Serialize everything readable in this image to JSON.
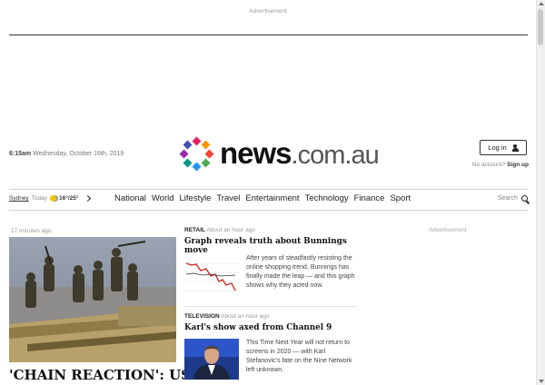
{
  "ad_top_label": "Advertisement",
  "header": {
    "dateline_location": "6:15am",
    "dateline_date": "Wednesday, October 16th, 2019",
    "logo_main": "news",
    "logo_domain": ".com.au",
    "login_label": "Log in",
    "no_account_text": "No account?",
    "signup_label": "Sign up",
    "logo_colors": [
      "#e91e63",
      "#ff9800",
      "#f44336",
      "#4caf50",
      "#2196f3",
      "#009688",
      "#9c27b0",
      "#3f51b5"
    ]
  },
  "nav": {
    "city": "Sydney",
    "today_label": "Today",
    "temps": "16°/25°",
    "links": [
      "National",
      "World",
      "Lifestyle",
      "Travel",
      "Entertainment",
      "Technology",
      "Finance",
      "Sport"
    ],
    "search_label": "Search"
  },
  "lead": {
    "time": "17 minutes ago",
    "title": "'CHAIN REACTION': US"
  },
  "stories": [
    {
      "category": "RETAIL",
      "time": "About an hour ago",
      "title": "Graph reveals truth about Bunnings move",
      "text": "After years of steadfastly resisting the online shopping trend, Bunnings has finally made the leap — and this graph shows why they acted now."
    },
    {
      "category": "TELEVISION",
      "time": "About an hour ago",
      "title": "Karl's show axed from Channel 9",
      "text": "This Time Next Year will not return to screens in 2020 — with Karl Stefanovic's fate on the Nine Network left unknown."
    }
  ],
  "ad_side_label": "Advertisement"
}
